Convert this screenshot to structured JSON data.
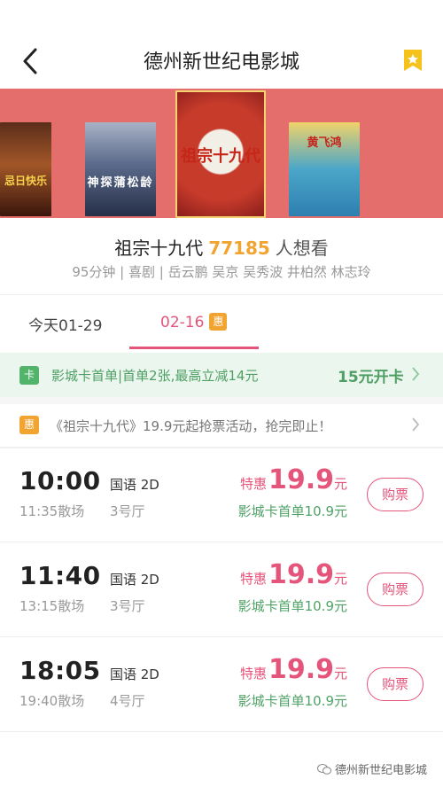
{
  "header": {
    "title": "德州新世纪电影城"
  },
  "carousel": {
    "posters": [
      {
        "label": "忌日快乐"
      },
      {
        "label": "神探蒲松龄"
      },
      {
        "label": "祖宗十九代"
      },
      {
        "label": "黄飞鸿"
      }
    ]
  },
  "movie": {
    "title": "祖宗十九代",
    "want_count": "77185",
    "want_label": "人想看",
    "meta": "95分钟 | 喜剧 | 岳云鹏 吴京 吴秀波 井柏然 林志玲"
  },
  "tabs": [
    {
      "label": "今天01-29"
    },
    {
      "label": "02-16",
      "badge": "惠"
    }
  ],
  "card_promo": {
    "badge": "卡",
    "text": "影城卡首单|首单2张,最高立减14元",
    "cta": "15元开卡"
  },
  "event_promo": {
    "badge": "惠",
    "text": "《祖宗十九代》19.9元起抢票活动，抢完即止！"
  },
  "showtimes": [
    {
      "start": "10:00",
      "end": "11:35散场",
      "lang": "国语 2D",
      "hall": "3号厅",
      "price_prefix": "特惠",
      "price": "19.9",
      "price_suffix": "元",
      "card_price": "影城卡首单10.9元",
      "buy": "购票"
    },
    {
      "start": "11:40",
      "end": "13:15散场",
      "lang": "国语 2D",
      "hall": "3号厅",
      "price_prefix": "特惠",
      "price": "19.9",
      "price_suffix": "元",
      "card_price": "影城卡首单10.9元",
      "buy": "购票"
    },
    {
      "start": "18:05",
      "end": "19:40散场",
      "lang": "国语 2D",
      "hall": "4号厅",
      "price_prefix": "特惠",
      "price": "19.9",
      "price_suffix": "元",
      "card_price": "影城卡首单10.9元",
      "buy": "购票"
    }
  ],
  "watermark": {
    "text": "德州新世纪电影城"
  },
  "colors": {
    "accent_pink": "#e5547a",
    "orange": "#f2a431",
    "green": "#52b36a",
    "banner_red": "#e46e6c"
  }
}
